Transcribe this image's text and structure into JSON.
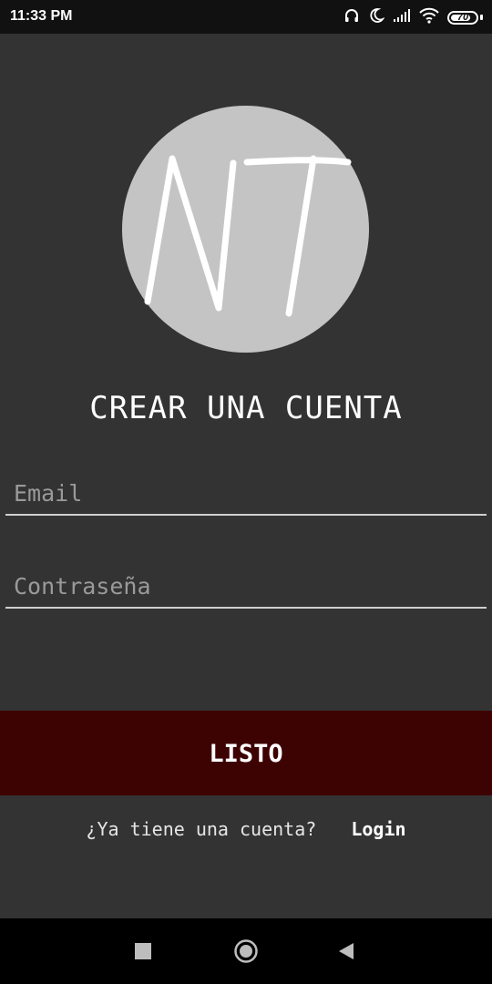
{
  "status_bar": {
    "time": "11:33 PM",
    "battery_level": "70",
    "icons": [
      "headphones-icon",
      "moon-icon",
      "signal-icon",
      "wifi-icon",
      "battery-icon"
    ]
  },
  "logo": {
    "text": "NT",
    "circle_color": "#c4c4c4",
    "stroke_color": "#ffffff"
  },
  "title": "CREAR UNA CUENTA",
  "form": {
    "email_placeholder": "Email",
    "password_placeholder": "Contraseña"
  },
  "submit_label": "LISTO",
  "login_prompt": "¿Ya tiene una cuenta?",
  "login_link": "Login",
  "colors": {
    "background": "#333333",
    "button": "#3d0202",
    "status_bar": "#111111",
    "nav_bar": "#000000"
  },
  "nav_bar": {
    "icons": [
      "recents-square-icon",
      "home-circle-icon",
      "back-triangle-icon"
    ]
  }
}
